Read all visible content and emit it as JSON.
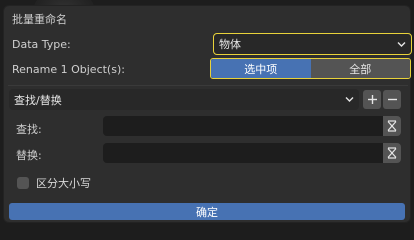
{
  "dialog": {
    "title": "批量重命名"
  },
  "data_type": {
    "label": "Data Type:",
    "value": "物体"
  },
  "rename": {
    "label": "Rename 1 Object(s):",
    "options": [
      "选中项",
      "全部"
    ],
    "selected": "选中项"
  },
  "operation": {
    "value": "查找/替换",
    "add_label": "+",
    "remove_label": "−"
  },
  "find": {
    "label": "查找:",
    "value": ""
  },
  "replace": {
    "label": "替换:",
    "value": ""
  },
  "case_sensitive": {
    "label": "区分大小写",
    "checked": false
  },
  "confirm_label": "确定",
  "colors": {
    "highlight": "#e8d23a",
    "accent": "#4772b3"
  }
}
